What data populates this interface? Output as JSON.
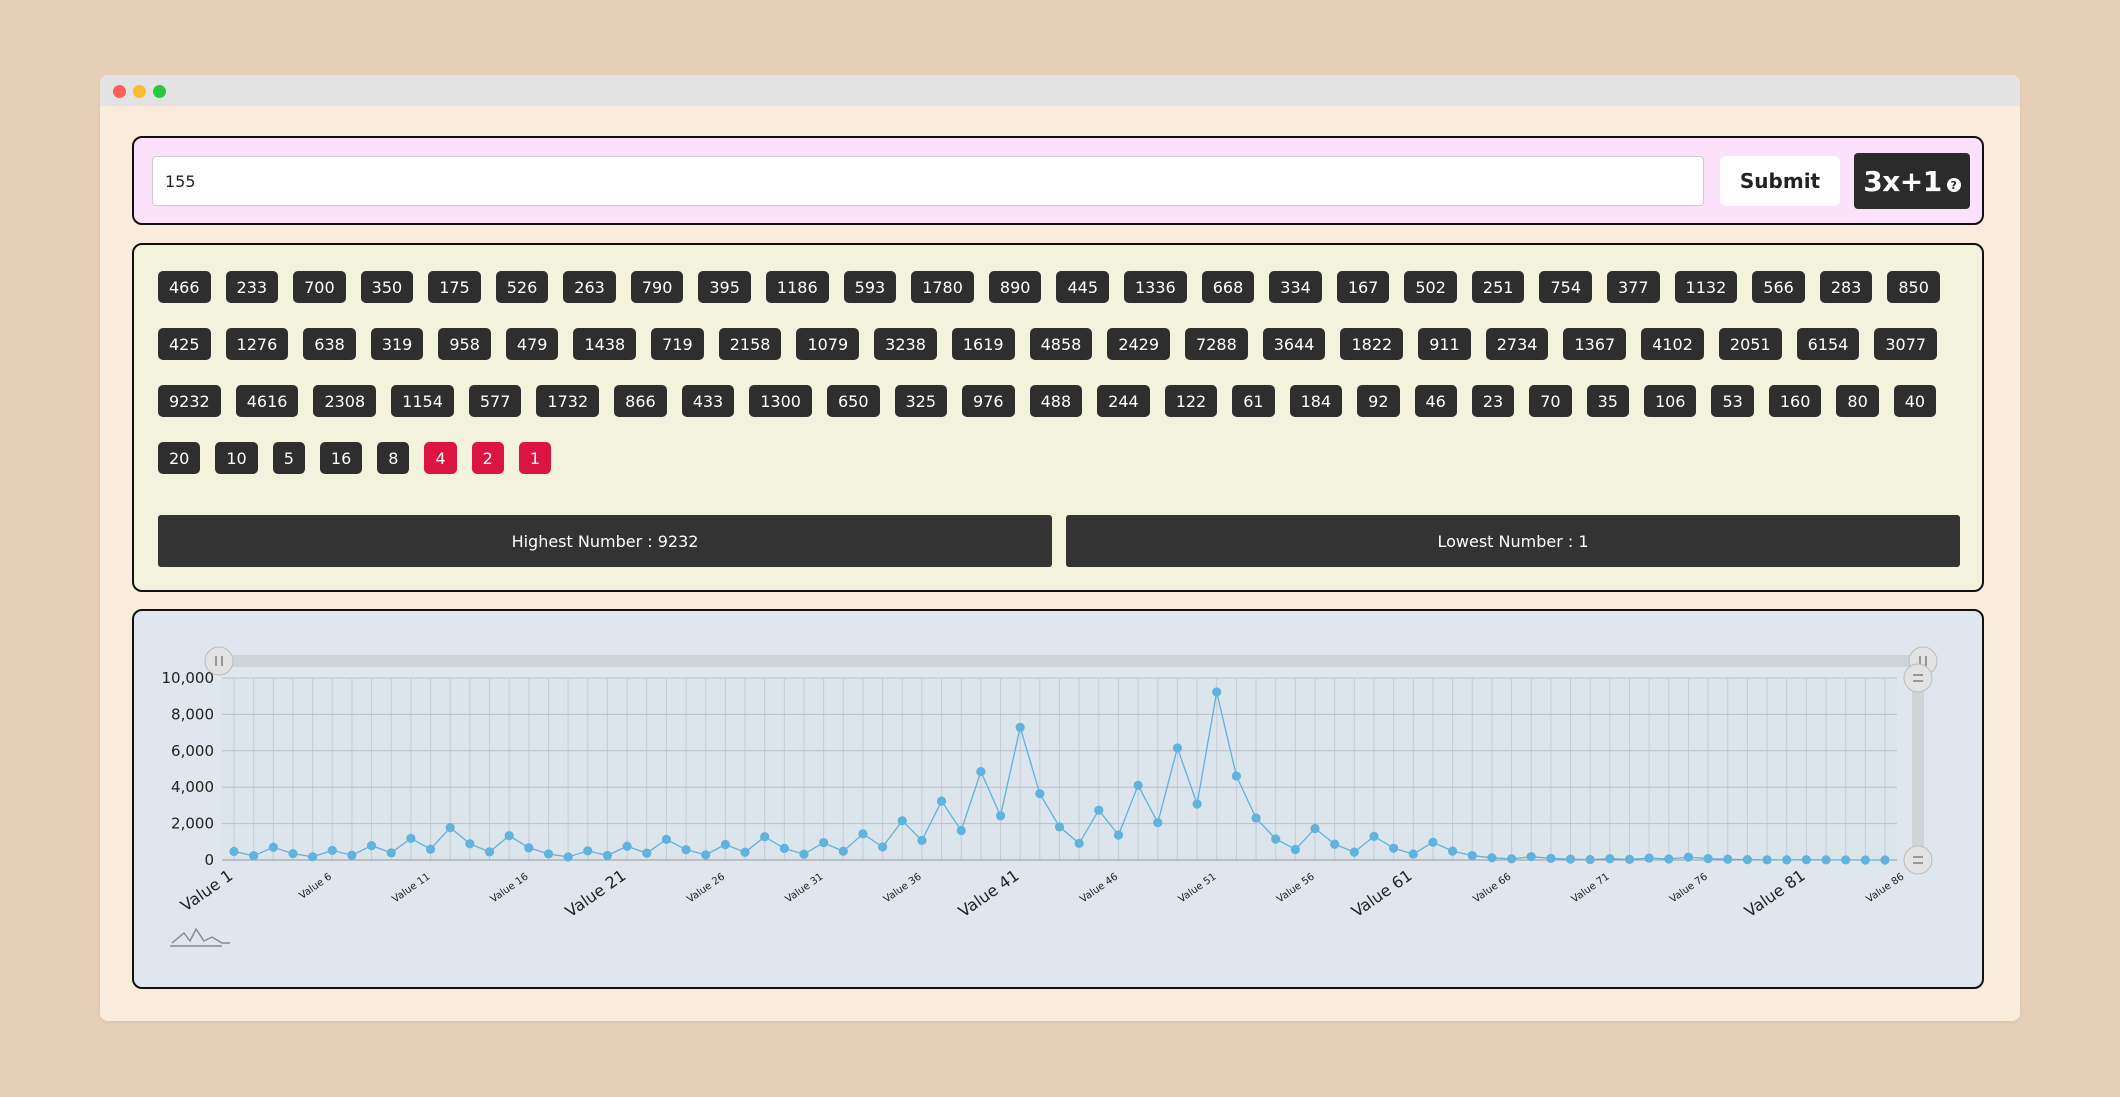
{
  "input": {
    "value": "155"
  },
  "submit_label": "Submit",
  "brand": {
    "title": "3x+1",
    "help_glyph": "?"
  },
  "sequence": [
    466,
    233,
    700,
    350,
    175,
    526,
    263,
    790,
    395,
    1186,
    593,
    1780,
    890,
    445,
    1336,
    668,
    334,
    167,
    502,
    251,
    754,
    377,
    1132,
    566,
    283,
    850,
    425,
    1276,
    638,
    319,
    958,
    479,
    1438,
    719,
    2158,
    1079,
    3238,
    1619,
    4858,
    2429,
    7288,
    3644,
    1822,
    911,
    2734,
    1367,
    4102,
    2051,
    6154,
    3077,
    9232,
    4616,
    2308,
    1154,
    577,
    1732,
    866,
    433,
    1300,
    650,
    325,
    976,
    488,
    244,
    122,
    61,
    184,
    92,
    46,
    23,
    70,
    35,
    106,
    53,
    160,
    80,
    40,
    20,
    10,
    5,
    16,
    8,
    4,
    2,
    1
  ],
  "highlight_values": [
    4,
    2,
    1
  ],
  "stats": {
    "highest_label": "Highest Number : 9232",
    "lowest_label": "Lowest Number : 1"
  },
  "colors": {
    "chip": "#2e2e2e",
    "chip_end": "#dc1442",
    "line": "#5fb3dc",
    "accent_input_panel": "#fce1fb",
    "accent_seq_panel": "#f3f3dd",
    "accent_chart_panel": "#dfe6ee"
  },
  "chart_data": {
    "type": "line",
    "title": "",
    "xlabel": "",
    "ylabel": "",
    "ylim": [
      0,
      10000
    ],
    "y_ticks": [
      "0",
      "2,000",
      "4,000",
      "6,000",
      "8,000",
      "10,000"
    ],
    "grid": true,
    "categories_prefix": "Value ",
    "x_tick_labels_large": [
      "Value 1",
      "Value 21",
      "Value 41",
      "Value 61",
      "Value 81"
    ],
    "x_tick_labels_small": [
      "Value 6",
      "Value 11",
      "Value 16",
      "Value 26",
      "Value 31",
      "Value 36",
      "Value 46",
      "Value 51",
      "Value 56",
      "Value 66",
      "Value 71",
      "Value 76",
      "Value 86"
    ],
    "series": [
      {
        "values": [
          466,
          233,
          700,
          350,
          175,
          526,
          263,
          790,
          395,
          1186,
          593,
          1780,
          890,
          445,
          1336,
          668,
          334,
          167,
          502,
          251,
          754,
          377,
          1132,
          566,
          283,
          850,
          425,
          1276,
          638,
          319,
          958,
          479,
          1438,
          719,
          2158,
          1079,
          3238,
          1619,
          4858,
          2429,
          7288,
          3644,
          1822,
          911,
          2734,
          1367,
          4102,
          2051,
          6154,
          3077,
          9232,
          4616,
          2308,
          1154,
          577,
          1732,
          866,
          433,
          1300,
          650,
          325,
          976,
          488,
          244,
          122,
          61,
          184,
          92,
          46,
          23,
          70,
          35,
          106,
          53,
          160,
          80,
          40,
          20,
          10,
          5,
          16,
          8,
          4,
          2,
          1
        ]
      }
    ]
  }
}
